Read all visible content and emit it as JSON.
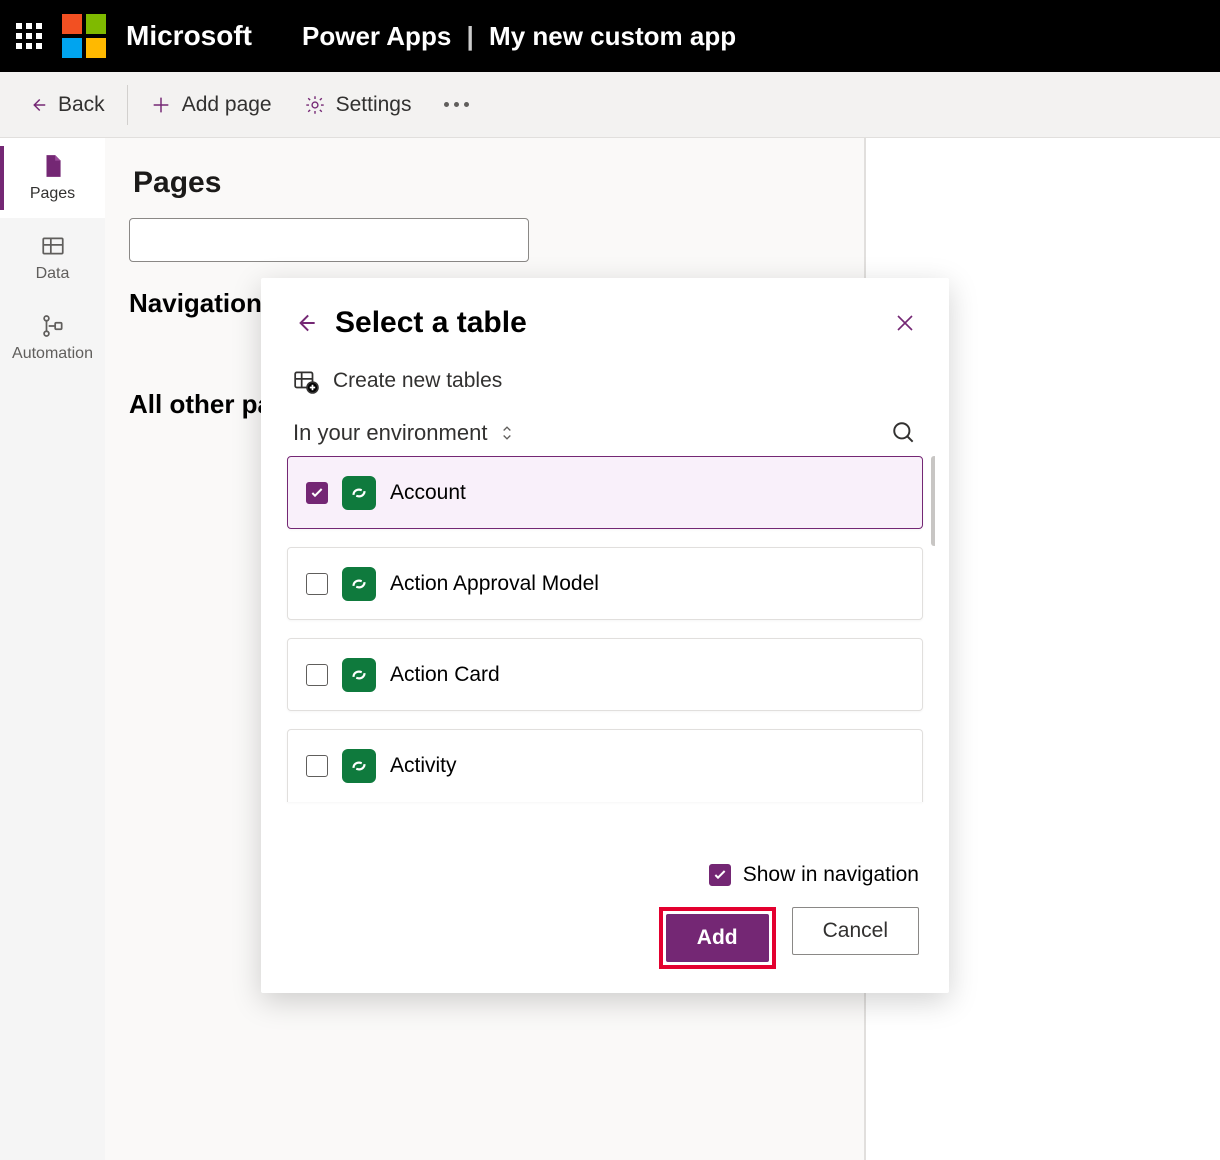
{
  "header": {
    "brand": "Microsoft",
    "app": "Power Apps",
    "subapp": "My new custom app"
  },
  "cmdbar": {
    "back": "Back",
    "add_page": "Add page",
    "settings": "Settings"
  },
  "rail": {
    "pages": "Pages",
    "data": "Data",
    "automation": "Automation"
  },
  "content": {
    "heading": "Pages",
    "nav_label": "Navigation",
    "all_label": "All other pages"
  },
  "dialog": {
    "title": "Select a table",
    "create_new": "Create new tables",
    "env_label": "In your environment",
    "tables": [
      {
        "name": "Account",
        "selected": true
      },
      {
        "name": "Action Approval Model",
        "selected": false
      },
      {
        "name": "Action Card",
        "selected": false
      },
      {
        "name": "Activity",
        "selected": false
      }
    ],
    "show_in_nav": "Show in navigation",
    "show_in_nav_checked": true,
    "add": "Add",
    "cancel": "Cancel"
  }
}
